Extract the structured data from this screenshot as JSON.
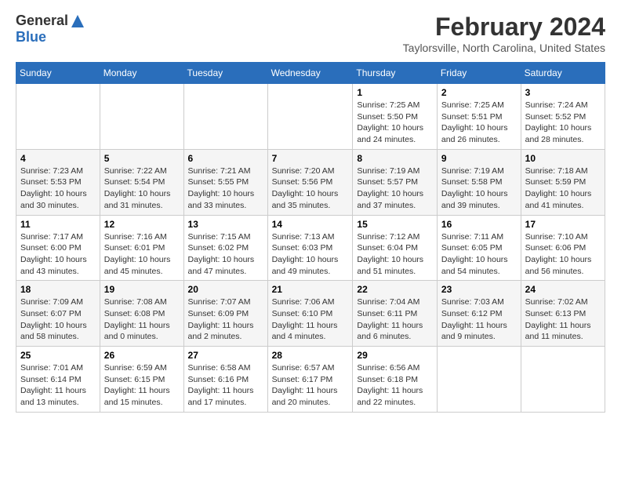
{
  "header": {
    "logo_general": "General",
    "logo_blue": "Blue",
    "month_year": "February 2024",
    "location": "Taylorsville, North Carolina, United States"
  },
  "weekdays": [
    "Sunday",
    "Monday",
    "Tuesday",
    "Wednesday",
    "Thursday",
    "Friday",
    "Saturday"
  ],
  "weeks": [
    [
      {
        "day": "",
        "info": ""
      },
      {
        "day": "",
        "info": ""
      },
      {
        "day": "",
        "info": ""
      },
      {
        "day": "",
        "info": ""
      },
      {
        "day": "1",
        "info": "Sunrise: 7:25 AM\nSunset: 5:50 PM\nDaylight: 10 hours\nand 24 minutes."
      },
      {
        "day": "2",
        "info": "Sunrise: 7:25 AM\nSunset: 5:51 PM\nDaylight: 10 hours\nand 26 minutes."
      },
      {
        "day": "3",
        "info": "Sunrise: 7:24 AM\nSunset: 5:52 PM\nDaylight: 10 hours\nand 28 minutes."
      }
    ],
    [
      {
        "day": "4",
        "info": "Sunrise: 7:23 AM\nSunset: 5:53 PM\nDaylight: 10 hours\nand 30 minutes."
      },
      {
        "day": "5",
        "info": "Sunrise: 7:22 AM\nSunset: 5:54 PM\nDaylight: 10 hours\nand 31 minutes."
      },
      {
        "day": "6",
        "info": "Sunrise: 7:21 AM\nSunset: 5:55 PM\nDaylight: 10 hours\nand 33 minutes."
      },
      {
        "day": "7",
        "info": "Sunrise: 7:20 AM\nSunset: 5:56 PM\nDaylight: 10 hours\nand 35 minutes."
      },
      {
        "day": "8",
        "info": "Sunrise: 7:19 AM\nSunset: 5:57 PM\nDaylight: 10 hours\nand 37 minutes."
      },
      {
        "day": "9",
        "info": "Sunrise: 7:19 AM\nSunset: 5:58 PM\nDaylight: 10 hours\nand 39 minutes."
      },
      {
        "day": "10",
        "info": "Sunrise: 7:18 AM\nSunset: 5:59 PM\nDaylight: 10 hours\nand 41 minutes."
      }
    ],
    [
      {
        "day": "11",
        "info": "Sunrise: 7:17 AM\nSunset: 6:00 PM\nDaylight: 10 hours\nand 43 minutes."
      },
      {
        "day": "12",
        "info": "Sunrise: 7:16 AM\nSunset: 6:01 PM\nDaylight: 10 hours\nand 45 minutes."
      },
      {
        "day": "13",
        "info": "Sunrise: 7:15 AM\nSunset: 6:02 PM\nDaylight: 10 hours\nand 47 minutes."
      },
      {
        "day": "14",
        "info": "Sunrise: 7:13 AM\nSunset: 6:03 PM\nDaylight: 10 hours\nand 49 minutes."
      },
      {
        "day": "15",
        "info": "Sunrise: 7:12 AM\nSunset: 6:04 PM\nDaylight: 10 hours\nand 51 minutes."
      },
      {
        "day": "16",
        "info": "Sunrise: 7:11 AM\nSunset: 6:05 PM\nDaylight: 10 hours\nand 54 minutes."
      },
      {
        "day": "17",
        "info": "Sunrise: 7:10 AM\nSunset: 6:06 PM\nDaylight: 10 hours\nand 56 minutes."
      }
    ],
    [
      {
        "day": "18",
        "info": "Sunrise: 7:09 AM\nSunset: 6:07 PM\nDaylight: 10 hours\nand 58 minutes."
      },
      {
        "day": "19",
        "info": "Sunrise: 7:08 AM\nSunset: 6:08 PM\nDaylight: 11 hours\nand 0 minutes."
      },
      {
        "day": "20",
        "info": "Sunrise: 7:07 AM\nSunset: 6:09 PM\nDaylight: 11 hours\nand 2 minutes."
      },
      {
        "day": "21",
        "info": "Sunrise: 7:06 AM\nSunset: 6:10 PM\nDaylight: 11 hours\nand 4 minutes."
      },
      {
        "day": "22",
        "info": "Sunrise: 7:04 AM\nSunset: 6:11 PM\nDaylight: 11 hours\nand 6 minutes."
      },
      {
        "day": "23",
        "info": "Sunrise: 7:03 AM\nSunset: 6:12 PM\nDaylight: 11 hours\nand 9 minutes."
      },
      {
        "day": "24",
        "info": "Sunrise: 7:02 AM\nSunset: 6:13 PM\nDaylight: 11 hours\nand 11 minutes."
      }
    ],
    [
      {
        "day": "25",
        "info": "Sunrise: 7:01 AM\nSunset: 6:14 PM\nDaylight: 11 hours\nand 13 minutes."
      },
      {
        "day": "26",
        "info": "Sunrise: 6:59 AM\nSunset: 6:15 PM\nDaylight: 11 hours\nand 15 minutes."
      },
      {
        "day": "27",
        "info": "Sunrise: 6:58 AM\nSunset: 6:16 PM\nDaylight: 11 hours\nand 17 minutes."
      },
      {
        "day": "28",
        "info": "Sunrise: 6:57 AM\nSunset: 6:17 PM\nDaylight: 11 hours\nand 20 minutes."
      },
      {
        "day": "29",
        "info": "Sunrise: 6:56 AM\nSunset: 6:18 PM\nDaylight: 11 hours\nand 22 minutes."
      },
      {
        "day": "",
        "info": ""
      },
      {
        "day": "",
        "info": ""
      }
    ]
  ]
}
